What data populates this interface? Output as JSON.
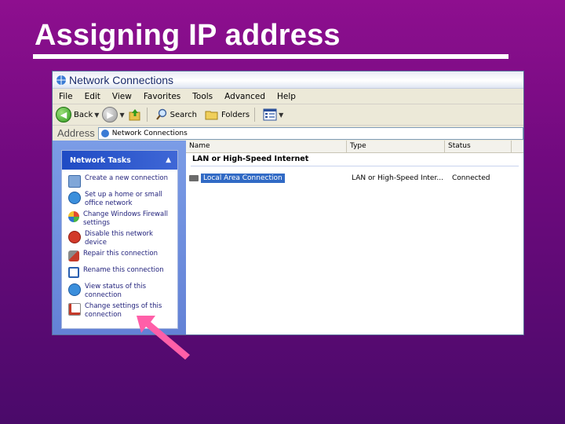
{
  "slide": {
    "title": "Assigning IP address",
    "background": "#7a0b85",
    "arrow_color": "#ff5fa8"
  },
  "window": {
    "title": "Network Connections",
    "menu": [
      "File",
      "Edit",
      "View",
      "Favorites",
      "Tools",
      "Advanced",
      "Help"
    ],
    "toolbar": {
      "back_label": "Back",
      "search_label": "Search",
      "folders_label": "Folders"
    },
    "address": {
      "label": "Address",
      "value": "Network Connections"
    }
  },
  "task_pane": {
    "header": "Network Tasks",
    "items": [
      {
        "icon": "create-connection-icon",
        "label": "Create a new connection"
      },
      {
        "icon": "home-network-icon",
        "label": "Set up a home or small office network"
      },
      {
        "icon": "firewall-icon",
        "label": "Change Windows Firewall settings"
      },
      {
        "icon": "disable-device-icon",
        "label": "Disable this network device"
      },
      {
        "icon": "repair-icon",
        "label": "Repair this connection"
      },
      {
        "icon": "rename-icon",
        "label": "Rename this connection"
      },
      {
        "icon": "view-status-icon",
        "label": "View status of this connection"
      },
      {
        "icon": "change-settings-icon",
        "label": "Change settings of this connection"
      }
    ]
  },
  "list": {
    "columns": [
      "Name",
      "Type",
      "Status"
    ],
    "group": "LAN or High-Speed Internet",
    "rows": [
      {
        "name": "Local Area Connection",
        "type": "LAN or High-Speed Inter...",
        "status": "Connected"
      }
    ]
  }
}
